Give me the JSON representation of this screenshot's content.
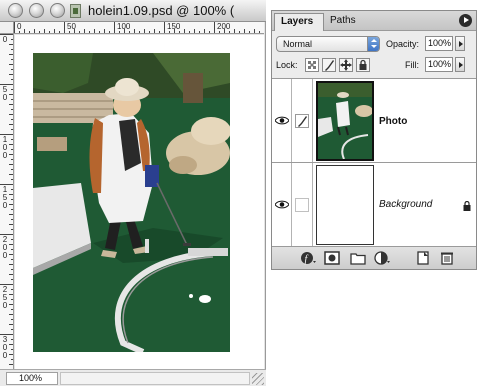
{
  "document": {
    "title": "holein1.09.psd @ 100% (",
    "zoom": "100%",
    "ruler_top_labels": [
      "0",
      "50",
      "100",
      "150",
      "200"
    ],
    "ruler_left_labels": [
      "0",
      "5 0",
      "1 0 0",
      "1 5 0",
      "2 0 0",
      "2 5 0",
      "3 0 0"
    ]
  },
  "layers_panel": {
    "tabs": [
      "Layers",
      "Paths"
    ],
    "blend_mode": "Normal",
    "opacity_label": "Opacity:",
    "opacity_value": "100%",
    "lock_label": "Lock:",
    "fill_label": "Fill:",
    "fill_value": "100%",
    "layers": [
      {
        "name": "Photo",
        "visible": true,
        "active": true
      },
      {
        "name": "Background",
        "visible": true,
        "locked": true
      }
    ],
    "footer_icons": [
      "link-layers-icon",
      "layer-style-icon",
      "layer-mask-icon",
      "new-group-icon",
      "adjustment-layer-icon",
      "new-layer-icon",
      "trash-icon"
    ]
  },
  "colors": {
    "green_turf": "#1f5a34",
    "panel_bg": "#ececec",
    "select_blue": "#3f74c5"
  }
}
